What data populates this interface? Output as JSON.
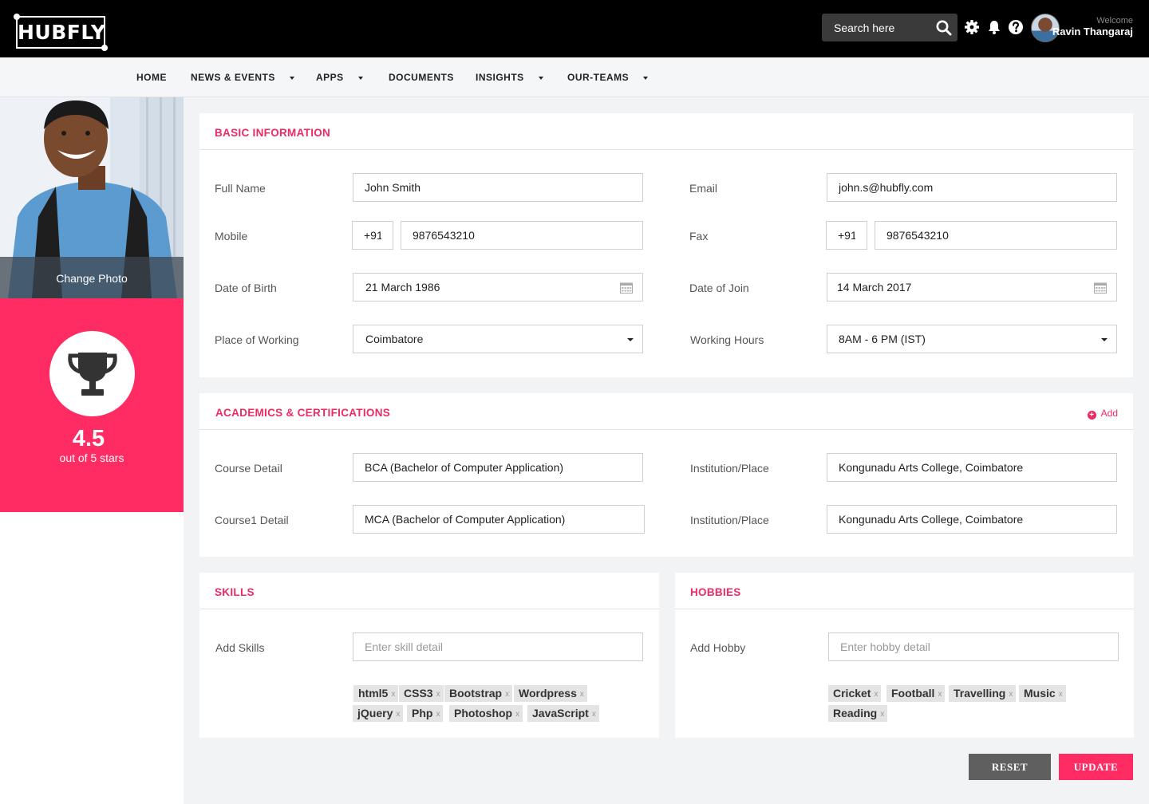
{
  "brand": {
    "logo_text": "HUBFLY"
  },
  "header": {
    "search_placeholder": "Search here",
    "icons": [
      "search-icon",
      "gear-icon",
      "bell-icon",
      "help-icon"
    ],
    "welcome_label": "Welcome",
    "user_name": "Ravin Thangaraj"
  },
  "nav": {
    "items": [
      {
        "label": "HOME",
        "dropdown": false
      },
      {
        "label": "NEWS & EVENTS",
        "dropdown": true
      },
      {
        "label": "APPS",
        "dropdown": true
      },
      {
        "label": "DOCUMENTS",
        "dropdown": false
      },
      {
        "label": "INSIGHTS",
        "dropdown": true
      },
      {
        "label": "OUR-TEAMS",
        "dropdown": true
      }
    ]
  },
  "profile": {
    "change_photo_label": "Change Photo",
    "rating": "4.5",
    "rating_caption": "out of 5 stars"
  },
  "basic_info": {
    "title": "BASIC INFORMATION",
    "full_name": {
      "label": "Full Name",
      "value": "John Smith"
    },
    "email": {
      "label": "Email",
      "value": "john.s@hubfly.com"
    },
    "mobile": {
      "label": "Mobile",
      "code": "+91",
      "value": "9876543210"
    },
    "fax": {
      "label": "Fax",
      "code": "+91",
      "value": "9876543210"
    },
    "dob": {
      "label": "Date of Birth",
      "value": "21 March 1986"
    },
    "doj": {
      "label": "Date of Join",
      "value": "14 March 2017"
    },
    "place": {
      "label": "Place of Working",
      "value": "Coimbatore"
    },
    "hours": {
      "label": "Working Hours",
      "value": "8AM - 6 PM (IST)"
    }
  },
  "academics": {
    "title": "ACADEMICS & CERTIFICATIONS",
    "add_label": "Add",
    "rows": [
      {
        "course_label": "Course Detail",
        "course": "BCA (Bachelor of Computer Application)",
        "inst_label": "Institution/Place",
        "inst": "Kongunadu Arts College, Coimbatore"
      },
      {
        "course_label": "Course1 Detail",
        "course": "MCA (Bachelor of Computer Application)",
        "inst_label": "Institution/Place",
        "inst": "Kongunadu Arts College, Coimbatore"
      }
    ]
  },
  "skills": {
    "title": "SKILLS",
    "label": "Add Skills",
    "placeholder": "Enter skill detail",
    "tags": [
      "html5",
      "CSS3",
      "Bootstrap",
      "Wordpress",
      "jQuery",
      "Php",
      "Photoshop",
      "JavaScript"
    ]
  },
  "hobbies": {
    "title": "HOBBIES",
    "label": "Add Hobby",
    "placeholder": "Enter hobby detail",
    "tags": [
      "Cricket",
      "Football",
      "Travelling",
      "Music",
      "Reading"
    ]
  },
  "actions": {
    "reset_label": "RESET",
    "update_label": "UPDATE"
  },
  "colors": {
    "accent": "#ec2b63",
    "rating_bg": "#ff2b63",
    "reset_bg": "#5f5f5f",
    "topbar_bg": "#000000"
  }
}
